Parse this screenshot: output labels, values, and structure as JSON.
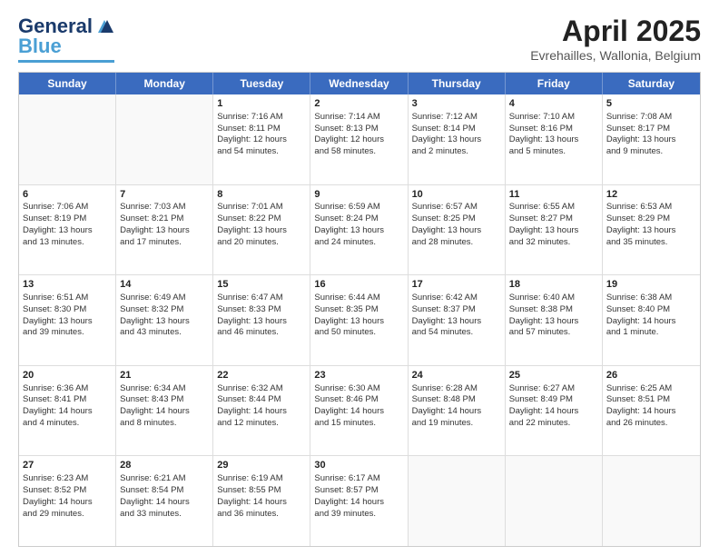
{
  "logo": {
    "text1": "General",
    "text2": "Blue"
  },
  "title": "April 2025",
  "subtitle": "Evrehailles, Wallonia, Belgium",
  "header_days": [
    "Sunday",
    "Monday",
    "Tuesday",
    "Wednesday",
    "Thursday",
    "Friday",
    "Saturday"
  ],
  "weeks": [
    [
      {
        "day": "",
        "lines": []
      },
      {
        "day": "",
        "lines": []
      },
      {
        "day": "1",
        "lines": [
          "Sunrise: 7:16 AM",
          "Sunset: 8:11 PM",
          "Daylight: 12 hours",
          "and 54 minutes."
        ]
      },
      {
        "day": "2",
        "lines": [
          "Sunrise: 7:14 AM",
          "Sunset: 8:13 PM",
          "Daylight: 12 hours",
          "and 58 minutes."
        ]
      },
      {
        "day": "3",
        "lines": [
          "Sunrise: 7:12 AM",
          "Sunset: 8:14 PM",
          "Daylight: 13 hours",
          "and 2 minutes."
        ]
      },
      {
        "day": "4",
        "lines": [
          "Sunrise: 7:10 AM",
          "Sunset: 8:16 PM",
          "Daylight: 13 hours",
          "and 5 minutes."
        ]
      },
      {
        "day": "5",
        "lines": [
          "Sunrise: 7:08 AM",
          "Sunset: 8:17 PM",
          "Daylight: 13 hours",
          "and 9 minutes."
        ]
      }
    ],
    [
      {
        "day": "6",
        "lines": [
          "Sunrise: 7:06 AM",
          "Sunset: 8:19 PM",
          "Daylight: 13 hours",
          "and 13 minutes."
        ]
      },
      {
        "day": "7",
        "lines": [
          "Sunrise: 7:03 AM",
          "Sunset: 8:21 PM",
          "Daylight: 13 hours",
          "and 17 minutes."
        ]
      },
      {
        "day": "8",
        "lines": [
          "Sunrise: 7:01 AM",
          "Sunset: 8:22 PM",
          "Daylight: 13 hours",
          "and 20 minutes."
        ]
      },
      {
        "day": "9",
        "lines": [
          "Sunrise: 6:59 AM",
          "Sunset: 8:24 PM",
          "Daylight: 13 hours",
          "and 24 minutes."
        ]
      },
      {
        "day": "10",
        "lines": [
          "Sunrise: 6:57 AM",
          "Sunset: 8:25 PM",
          "Daylight: 13 hours",
          "and 28 minutes."
        ]
      },
      {
        "day": "11",
        "lines": [
          "Sunrise: 6:55 AM",
          "Sunset: 8:27 PM",
          "Daylight: 13 hours",
          "and 32 minutes."
        ]
      },
      {
        "day": "12",
        "lines": [
          "Sunrise: 6:53 AM",
          "Sunset: 8:29 PM",
          "Daylight: 13 hours",
          "and 35 minutes."
        ]
      }
    ],
    [
      {
        "day": "13",
        "lines": [
          "Sunrise: 6:51 AM",
          "Sunset: 8:30 PM",
          "Daylight: 13 hours",
          "and 39 minutes."
        ]
      },
      {
        "day": "14",
        "lines": [
          "Sunrise: 6:49 AM",
          "Sunset: 8:32 PM",
          "Daylight: 13 hours",
          "and 43 minutes."
        ]
      },
      {
        "day": "15",
        "lines": [
          "Sunrise: 6:47 AM",
          "Sunset: 8:33 PM",
          "Daylight: 13 hours",
          "and 46 minutes."
        ]
      },
      {
        "day": "16",
        "lines": [
          "Sunrise: 6:44 AM",
          "Sunset: 8:35 PM",
          "Daylight: 13 hours",
          "and 50 minutes."
        ]
      },
      {
        "day": "17",
        "lines": [
          "Sunrise: 6:42 AM",
          "Sunset: 8:37 PM",
          "Daylight: 13 hours",
          "and 54 minutes."
        ]
      },
      {
        "day": "18",
        "lines": [
          "Sunrise: 6:40 AM",
          "Sunset: 8:38 PM",
          "Daylight: 13 hours",
          "and 57 minutes."
        ]
      },
      {
        "day": "19",
        "lines": [
          "Sunrise: 6:38 AM",
          "Sunset: 8:40 PM",
          "Daylight: 14 hours",
          "and 1 minute."
        ]
      }
    ],
    [
      {
        "day": "20",
        "lines": [
          "Sunrise: 6:36 AM",
          "Sunset: 8:41 PM",
          "Daylight: 14 hours",
          "and 4 minutes."
        ]
      },
      {
        "day": "21",
        "lines": [
          "Sunrise: 6:34 AM",
          "Sunset: 8:43 PM",
          "Daylight: 14 hours",
          "and 8 minutes."
        ]
      },
      {
        "day": "22",
        "lines": [
          "Sunrise: 6:32 AM",
          "Sunset: 8:44 PM",
          "Daylight: 14 hours",
          "and 12 minutes."
        ]
      },
      {
        "day": "23",
        "lines": [
          "Sunrise: 6:30 AM",
          "Sunset: 8:46 PM",
          "Daylight: 14 hours",
          "and 15 minutes."
        ]
      },
      {
        "day": "24",
        "lines": [
          "Sunrise: 6:28 AM",
          "Sunset: 8:48 PM",
          "Daylight: 14 hours",
          "and 19 minutes."
        ]
      },
      {
        "day": "25",
        "lines": [
          "Sunrise: 6:27 AM",
          "Sunset: 8:49 PM",
          "Daylight: 14 hours",
          "and 22 minutes."
        ]
      },
      {
        "day": "26",
        "lines": [
          "Sunrise: 6:25 AM",
          "Sunset: 8:51 PM",
          "Daylight: 14 hours",
          "and 26 minutes."
        ]
      }
    ],
    [
      {
        "day": "27",
        "lines": [
          "Sunrise: 6:23 AM",
          "Sunset: 8:52 PM",
          "Daylight: 14 hours",
          "and 29 minutes."
        ]
      },
      {
        "day": "28",
        "lines": [
          "Sunrise: 6:21 AM",
          "Sunset: 8:54 PM",
          "Daylight: 14 hours",
          "and 33 minutes."
        ]
      },
      {
        "day": "29",
        "lines": [
          "Sunrise: 6:19 AM",
          "Sunset: 8:55 PM",
          "Daylight: 14 hours",
          "and 36 minutes."
        ]
      },
      {
        "day": "30",
        "lines": [
          "Sunrise: 6:17 AM",
          "Sunset: 8:57 PM",
          "Daylight: 14 hours",
          "and 39 minutes."
        ]
      },
      {
        "day": "",
        "lines": []
      },
      {
        "day": "",
        "lines": []
      },
      {
        "day": "",
        "lines": []
      }
    ]
  ]
}
